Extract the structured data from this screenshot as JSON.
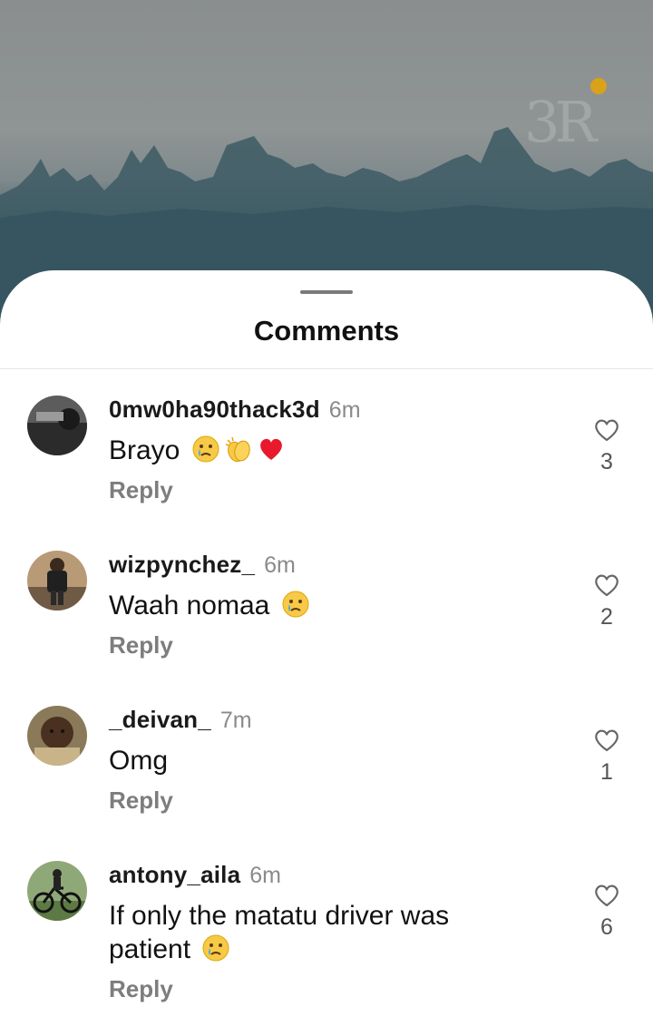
{
  "video": {
    "watermark": "3R",
    "record_color": "#d8a21b"
  },
  "sheet": {
    "title": "Comments"
  },
  "comments": [
    {
      "username": "0mw0ha90thack3d",
      "time": "6m",
      "text": "Brayo",
      "emojis": [
        "crying-face",
        "clapping-hands",
        "red-heart"
      ],
      "reply_label": "Reply",
      "likes": "3"
    },
    {
      "username": "wizpynchez_",
      "time": "6m",
      "text": "Waah nomaa",
      "emojis": [
        "crying-face"
      ],
      "reply_label": "Reply",
      "likes": "2"
    },
    {
      "username": "_deivan_",
      "time": "7m",
      "text": "Omg",
      "emojis": [],
      "reply_label": "Reply",
      "likes": "1"
    },
    {
      "username": "antony_aila",
      "time": "6m",
      "text": "If only the matatu driver was patient",
      "emojis": [
        "crying-face"
      ],
      "reply_label": "Reply",
      "likes": "6"
    }
  ]
}
